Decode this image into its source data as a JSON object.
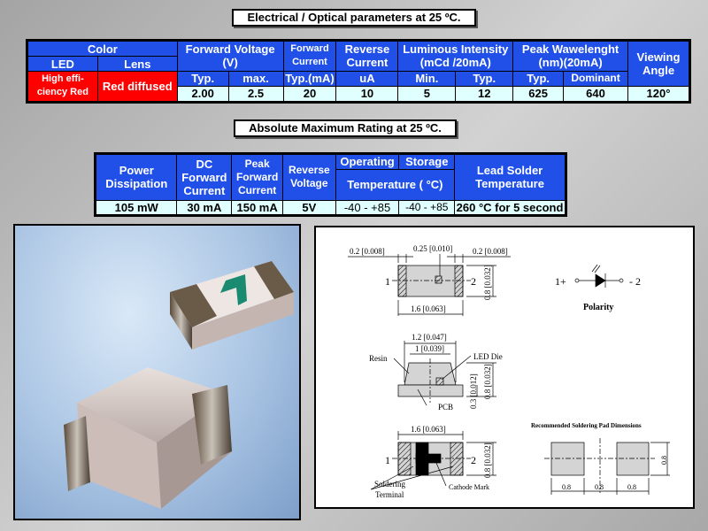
{
  "titles": {
    "electrical": "Electrical  /  Optical parameters at 25 ºC.",
    "absolute": "Absolute Maximum Rating at 25 ºC."
  },
  "electrical": {
    "headers": {
      "color": "Color",
      "led": "LED",
      "lens": "Lens",
      "forward_voltage": "Forward Voltage (V)",
      "forward_current": "Forward Current",
      "reverse_current": "Reverse Current",
      "luminous": "Luminous Intensity (mCd /20mA)",
      "peak": "Peak Wawelenght (nm)(20mA)",
      "viewing": "Viewing Angle"
    },
    "sub": {
      "fv_typ": "Typ.",
      "fv_max": "max.",
      "fc_typ": "Typ.(mA)",
      "rc_unit": "uA",
      "li_min": "Min.",
      "li_typ": "Typ.",
      "pw_typ": "Typ.",
      "pw_dom": "Dominant"
    },
    "led": "High effi-ciency Red",
    "lens": "Red diffused",
    "values": {
      "fv_typ": "2.00",
      "fv_max": "2.5",
      "fc": "20",
      "rc": "10",
      "li_min": "5",
      "li_typ": "12",
      "pw_typ": "625",
      "pw_dom": "640",
      "viewing": "120°"
    }
  },
  "absolute": {
    "headers": {
      "power": "Power Dissipation",
      "dc": "DC Forward Current",
      "peak": "Peak Forward Current",
      "reverse": "Reverse Voltage",
      "operating": "Operating",
      "storage": "Storage",
      "temperature": "Temperature ( °C)",
      "lead": "Lead Solder Temperature"
    },
    "values": {
      "power": "105 mW",
      "dc": "30 mA",
      "peak": "150 mA",
      "reverse": "5V",
      "operating": "-40 - +85",
      "storage": "-40 - +85",
      "lead": "260 °C for 5 second"
    }
  },
  "diagram": {
    "dim_02_left": "0.2 [0.008]",
    "dim_025": "0.25 [0.010]",
    "dim_02_right": "0.2 [0.008]",
    "dim_16": "1.6 [0.063]",
    "dim_08": "0.8 [0.032]",
    "pin1": "1",
    "pin2": "2",
    "polarity_left": "1+",
    "polarity_right": "- 2",
    "polarity": "Polarity",
    "dim_12": "1.2 [0.047]",
    "dim_1": "1 [0.039]",
    "resin": "Resin",
    "led_die": "LED Die",
    "pcb": "PCB",
    "dim_03": "0.3 [0.012]",
    "soldering": "Soldering",
    "terminal": "Terminal",
    "cathode": "Cathode Mark",
    "pad_title": "Recommended Soldering Pad Dimensions",
    "pad_dim": "0.8"
  }
}
